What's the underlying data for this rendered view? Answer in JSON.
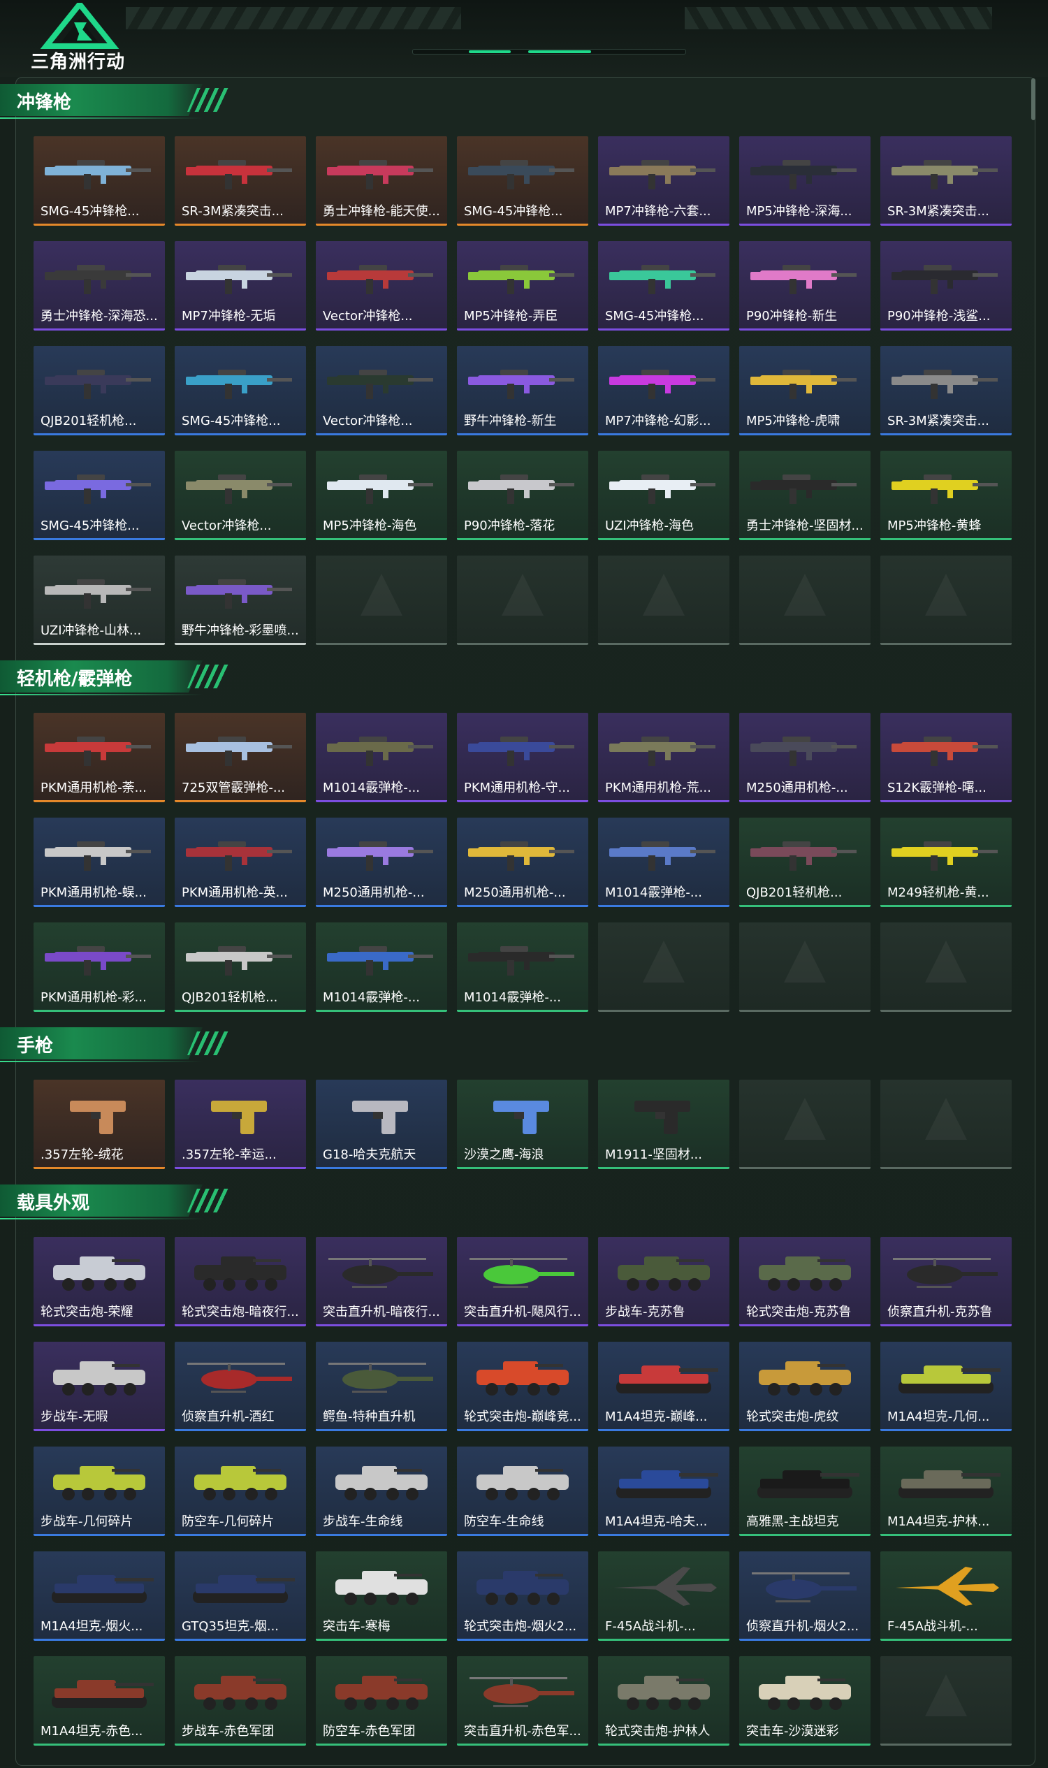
{
  "header": {
    "logo_text": "三角洲行动",
    "accent_color": "#1fd88a"
  },
  "quality_colors": {
    "gold": "#e4882a",
    "purple": "#7c4ee0",
    "blue": "#3a7ae0",
    "green": "#35c07a",
    "white": "#c8d0cc"
  },
  "sections": [
    {
      "title": "冲锋枪",
      "items": [
        {
          "label": "SMG-45冲锋枪...",
          "quality": "gold",
          "kind": "gun",
          "color": "#7fb2d8"
        },
        {
          "label": "SR-3M紧凑突击...",
          "quality": "gold",
          "kind": "gun",
          "color": "#c8323c"
        },
        {
          "label": "勇士冲锋枪-能天使...",
          "quality": "gold",
          "kind": "gun",
          "color": "#c83a5c"
        },
        {
          "label": "SMG-45冲锋枪...",
          "quality": "gold",
          "kind": "gun",
          "color": "#3a4a5a"
        },
        {
          "label": "MP7冲锋枪-六套...",
          "quality": "purple",
          "kind": "gun",
          "color": "#8a7a5a"
        },
        {
          "label": "MP5冲锋枪-深海...",
          "quality": "purple",
          "kind": "gun",
          "color": "#2a2e38"
        },
        {
          "label": "SR-3M紧凑突击...",
          "quality": "purple",
          "kind": "gun",
          "color": "#8a8a6a"
        },
        {
          "label": "勇士冲锋枪-深海恐...",
          "quality": "purple",
          "kind": "gun",
          "color": "#3a3a3a"
        },
        {
          "label": "MP7冲锋枪-无垢",
          "quality": "purple",
          "kind": "gun",
          "color": "#c8d4e0"
        },
        {
          "label": "Vector冲锋枪...",
          "quality": "purple",
          "kind": "gun",
          "color": "#b83a3a"
        },
        {
          "label": "MP5冲锋枪-弄臣",
          "quality": "purple",
          "kind": "gun",
          "color": "#8ac83a"
        },
        {
          "label": "SMG-45冲锋枪...",
          "quality": "purple",
          "kind": "gun",
          "color": "#3ac89a"
        },
        {
          "label": "P90冲锋枪-新生",
          "quality": "purple",
          "kind": "gun",
          "color": "#e07ac8"
        },
        {
          "label": "P90冲锋枪-浅鲨...",
          "quality": "purple",
          "kind": "gun",
          "color": "#2a2a30"
        },
        {
          "label": "QJB201轻机枪...",
          "quality": "blue",
          "kind": "gun",
          "color": "#3a3a5a"
        },
        {
          "label": "SMG-45冲锋枪...",
          "quality": "blue",
          "kind": "gun",
          "color": "#3aa0c8"
        },
        {
          "label": "Vector冲锋枪...",
          "quality": "blue",
          "kind": "gun",
          "color": "#2a3a30"
        },
        {
          "label": "野牛冲锋枪-新生",
          "quality": "blue",
          "kind": "gun",
          "color": "#8a5ae0"
        },
        {
          "label": "MP7冲锋枪-幻影...",
          "quality": "blue",
          "kind": "gun",
          "color": "#c83ae0"
        },
        {
          "label": "MP5冲锋枪-虎啸",
          "quality": "blue",
          "kind": "gun",
          "color": "#e0b83a"
        },
        {
          "label": "SR-3M紧凑突击...",
          "quality": "blue",
          "kind": "gun",
          "color": "#8a8a8a"
        },
        {
          "label": "SMG-45冲锋枪...",
          "quality": "blue",
          "kind": "gun",
          "color": "#7a6ae0"
        },
        {
          "label": "Vector冲锋枪...",
          "quality": "green",
          "kind": "gun",
          "color": "#8a8a6a"
        },
        {
          "label": "MP5冲锋枪-海色",
          "quality": "green",
          "kind": "gun",
          "color": "#e0e8f0"
        },
        {
          "label": "P90冲锋枪-落花",
          "quality": "green",
          "kind": "gun",
          "color": "#c8c8cc"
        },
        {
          "label": "UZI冲锋枪-海色",
          "quality": "green",
          "kind": "gun",
          "color": "#e8eef4"
        },
        {
          "label": "勇士冲锋枪-坚固材...",
          "quality": "green",
          "kind": "gun",
          "color": "#2a2a2a"
        },
        {
          "label": "MP5冲锋枪-黄蜂",
          "quality": "green",
          "kind": "gun",
          "color": "#e0d020"
        },
        {
          "label": "UZI冲锋枪-山林...",
          "quality": "white",
          "kind": "gun",
          "color": "#b8b8b8"
        },
        {
          "label": "野牛冲锋枪-彩墨喷...",
          "quality": "white",
          "kind": "gun",
          "color": "#7a5ac8"
        },
        {
          "label": "",
          "quality": "empty"
        },
        {
          "label": "",
          "quality": "empty"
        },
        {
          "label": "",
          "quality": "empty"
        },
        {
          "label": "",
          "quality": "empty"
        },
        {
          "label": "",
          "quality": "empty"
        }
      ]
    },
    {
      "title": "轻机枪/霰弹枪",
      "items": [
        {
          "label": "PKM通用机枪-荼...",
          "quality": "gold",
          "kind": "gun",
          "color": "#c83a3a"
        },
        {
          "label": "725双管霰弹枪-...",
          "quality": "gold",
          "kind": "gun",
          "color": "#a8c0e0"
        },
        {
          "label": "M1014霰弹枪-...",
          "quality": "purple",
          "kind": "gun",
          "color": "#6a6a4a"
        },
        {
          "label": "PKM通用机枪-守...",
          "quality": "purple",
          "kind": "gun",
          "color": "#3a4a9a"
        },
        {
          "label": "PKM通用机枪-荒...",
          "quality": "purple",
          "kind": "gun",
          "color": "#7a7a5a"
        },
        {
          "label": "M250通用机枪-...",
          "quality": "purple",
          "kind": "gun",
          "color": "#4a4a5a"
        },
        {
          "label": "S12K霰弹枪-曙...",
          "quality": "purple",
          "kind": "gun",
          "color": "#c84a3a"
        },
        {
          "label": "PKM通用机枪-蜈...",
          "quality": "blue",
          "kind": "gun",
          "color": "#c8c8c8"
        },
        {
          "label": "PKM通用机枪-英...",
          "quality": "blue",
          "kind": "gun",
          "color": "#a8323a"
        },
        {
          "label": "M250通用机枪-...",
          "quality": "blue",
          "kind": "gun",
          "color": "#9a7ae0"
        },
        {
          "label": "M250通用机枪-...",
          "quality": "blue",
          "kind": "gun",
          "color": "#e0b83a"
        },
        {
          "label": "M1014霰弹枪-...",
          "quality": "blue",
          "kind": "gun",
          "color": "#5a7ac8"
        },
        {
          "label": "QJB201轻机枪...",
          "quality": "green",
          "kind": "gun",
          "color": "#7a4a5a"
        },
        {
          "label": "M249轻机枪-黄...",
          "quality": "green",
          "kind": "gun",
          "color": "#e0d020"
        },
        {
          "label": "PKM通用机枪-彩...",
          "quality": "green",
          "kind": "gun",
          "color": "#7a4ac8"
        },
        {
          "label": "QJB201轻机枪...",
          "quality": "green",
          "kind": "gun",
          "color": "#c8c8c8"
        },
        {
          "label": "M1014霰弹枪-...",
          "quality": "green",
          "kind": "gun",
          "color": "#3a6ac8"
        },
        {
          "label": "M1014霰弹枪-...",
          "quality": "green",
          "kind": "gun",
          "color": "#2a2a2a"
        },
        {
          "label": "",
          "quality": "empty"
        },
        {
          "label": "",
          "quality": "empty"
        },
        {
          "label": "",
          "quality": "empty"
        }
      ]
    },
    {
      "title": "手枪",
      "items": [
        {
          "label": ".357左轮-绒花",
          "quality": "gold",
          "kind": "pistol",
          "color": "#c88a5a"
        },
        {
          "label": ".357左轮-幸运...",
          "quality": "purple",
          "kind": "pistol",
          "color": "#c8a83a"
        },
        {
          "label": "G18-哈夫克航天",
          "quality": "blue",
          "kind": "pistol",
          "color": "#b8b8c0"
        },
        {
          "label": "沙漠之鹰-海浪",
          "quality": "green",
          "kind": "pistol",
          "color": "#5a8ae0"
        },
        {
          "label": "M1911-坚固材...",
          "quality": "green",
          "kind": "pistol",
          "color": "#2a2a2a"
        },
        {
          "label": "",
          "quality": "empty"
        },
        {
          "label": "",
          "quality": "empty"
        }
      ]
    },
    {
      "title": "载具外观",
      "items": [
        {
          "label": "轮式突击炮-荣耀",
          "quality": "purple",
          "kind": "vehicle",
          "color": "#c8ccd4"
        },
        {
          "label": "轮式突击炮-暗夜行...",
          "quality": "purple",
          "kind": "vehicle",
          "color": "#2a2a2a"
        },
        {
          "label": "突击直升机-暗夜行...",
          "quality": "purple",
          "kind": "heli",
          "color": "#2a2a2a"
        },
        {
          "label": "突击直升机-飓风行...",
          "quality": "purple",
          "kind": "heli",
          "color": "#4ac83a"
        },
        {
          "label": "步战车-克苏鲁",
          "quality": "purple",
          "kind": "vehicle",
          "color": "#4a5a3a"
        },
        {
          "label": "轮式突击炮-克苏鲁",
          "quality": "purple",
          "kind": "vehicle",
          "color": "#5a6a4a"
        },
        {
          "label": "侦察直升机-克苏鲁",
          "quality": "purple",
          "kind": "heli",
          "color": "#2a2a2a"
        },
        {
          "label": "步战车-无暇",
          "quality": "purple",
          "kind": "vehicle",
          "color": "#c8c8c8"
        },
        {
          "label": "侦察直升机-酒红",
          "quality": "blue",
          "kind": "heli",
          "color": "#a82a2a"
        },
        {
          "label": "鳄鱼-特种直升机",
          "quality": "blue",
          "kind": "heli",
          "color": "#4a5a3a"
        },
        {
          "label": "轮式突击炮-巅峰竞...",
          "quality": "blue",
          "kind": "vehicle",
          "color": "#d84a2a"
        },
        {
          "label": "M1A4坦克-巅峰...",
          "quality": "blue",
          "kind": "tank",
          "color": "#c83a3a"
        },
        {
          "label": "轮式突击炮-虎纹",
          "quality": "blue",
          "kind": "vehicle",
          "color": "#c89a3a"
        },
        {
          "label": "M1A4坦克-几何...",
          "quality": "blue",
          "kind": "tank",
          "color": "#b8c83a"
        },
        {
          "label": "步战车-几何碎片",
          "quality": "blue",
          "kind": "vehicle",
          "color": "#b8c83a"
        },
        {
          "label": "防空车-几何碎片",
          "quality": "blue",
          "kind": "vehicle",
          "color": "#b8c83a"
        },
        {
          "label": "步战车-生命线",
          "quality": "blue",
          "kind": "vehicle",
          "color": "#c8c8c8"
        },
        {
          "label": "防空车-生命线",
          "quality": "blue",
          "kind": "vehicle",
          "color": "#c8c8c8"
        },
        {
          "label": "M1A4坦克-哈夫...",
          "quality": "blue",
          "kind": "tank",
          "color": "#2a4a9a"
        },
        {
          "label": "高雅黑-主战坦克",
          "quality": "green",
          "kind": "tank",
          "color": "#1a1a1a"
        },
        {
          "label": "M1A4坦克-护林...",
          "quality": "green",
          "kind": "tank",
          "color": "#6a6a5a"
        },
        {
          "label": "M1A4坦克-烟火...",
          "quality": "blue",
          "kind": "tank",
          "color": "#2a3a6a"
        },
        {
          "label": "GTQ35坦克-烟...",
          "quality": "blue",
          "kind": "tank",
          "color": "#2a3a6a"
        },
        {
          "label": "突击车-寒梅",
          "quality": "green",
          "kind": "vehicle",
          "color": "#e0e0e0"
        },
        {
          "label": "轮式突击炮-烟火2...",
          "quality": "blue",
          "kind": "vehicle",
          "color": "#2a3a6a"
        },
        {
          "label": "F-45A战斗机-...",
          "quality": "green",
          "kind": "jet",
          "color": "#4a4a4a"
        },
        {
          "label": "侦察直升机-烟火2...",
          "quality": "blue",
          "kind": "heli",
          "color": "#2a3a6a"
        },
        {
          "label": "F-45A战斗机-...",
          "quality": "green",
          "kind": "jet",
          "color": "#e0a020"
        },
        {
          "label": "M1A4坦克-赤色...",
          "quality": "green",
          "kind": "tank",
          "color": "#8a3a2a"
        },
        {
          "label": "步战车-赤色军团",
          "quality": "green",
          "kind": "vehicle",
          "color": "#8a3a2a"
        },
        {
          "label": "防空车-赤色军团",
          "quality": "green",
          "kind": "vehicle",
          "color": "#8a3a2a"
        },
        {
          "label": "突击直升机-赤色军...",
          "quality": "green",
          "kind": "heli",
          "color": "#8a3a2a"
        },
        {
          "label": "轮式突击炮-护林人",
          "quality": "green",
          "kind": "vehicle",
          "color": "#7a7a6a"
        },
        {
          "label": "突击车-沙漠迷彩",
          "quality": "green",
          "kind": "vehicle",
          "color": "#d8d0b8"
        },
        {
          "label": "",
          "quality": "empty"
        }
      ]
    }
  ]
}
